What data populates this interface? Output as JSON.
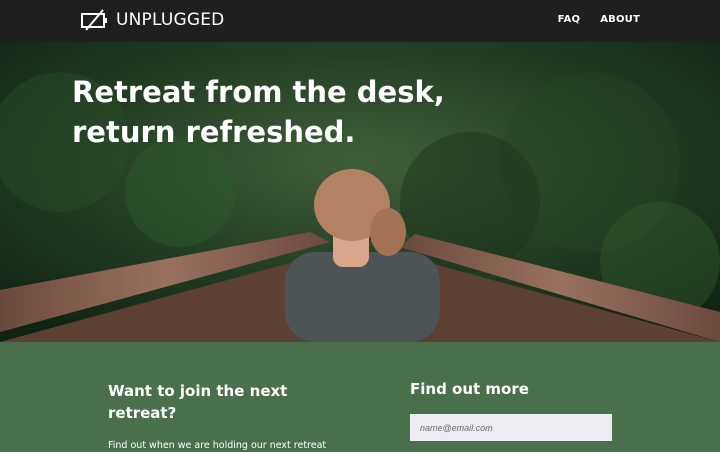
{
  "brand": {
    "name": "UNPLUGGED",
    "icon": "battery-slash-icon"
  },
  "nav": {
    "items": [
      "FAQ",
      "ABOUT"
    ]
  },
  "hero": {
    "title": "Retreat from the desk, return refreshed."
  },
  "join": {
    "title": "Want to join the next retreat?",
    "text": "Find out when we are holding our next retreat"
  },
  "find": {
    "title": "Find out more",
    "placeholder": "name@email.com"
  },
  "colors": {
    "nav_bg": "#1f1f1f",
    "section_bg": "#4a6f4d",
    "input_bg": "#ececf3"
  }
}
